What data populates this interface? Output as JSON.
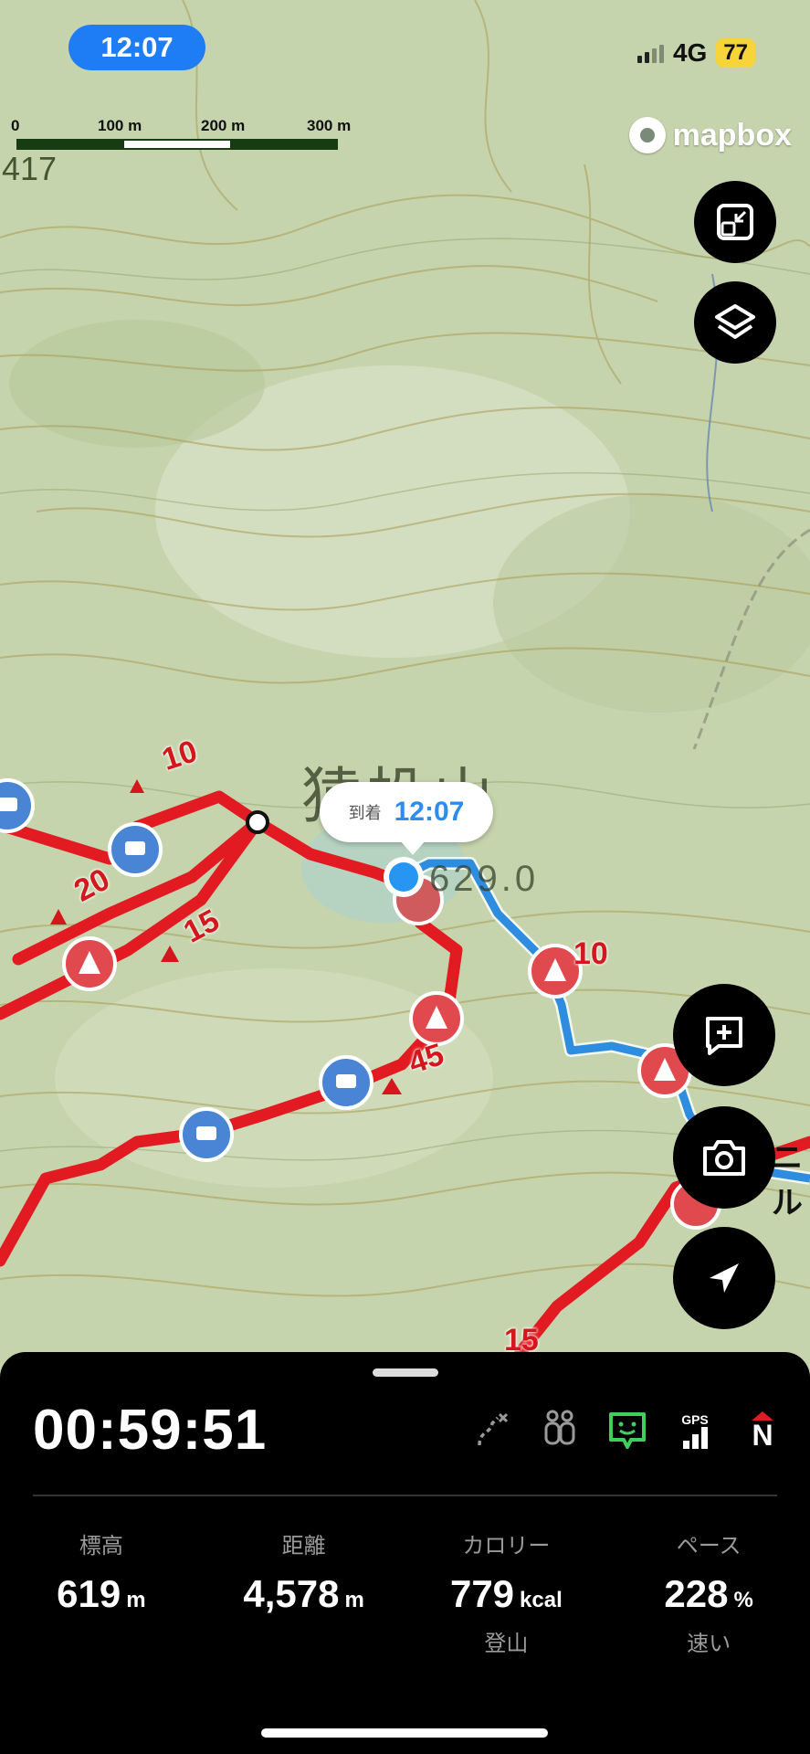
{
  "status_bar": {
    "time": "12:07",
    "network": "4G",
    "battery": "77"
  },
  "map": {
    "scale": {
      "labels": [
        "0",
        "100 m",
        "200 m",
        "300 m"
      ]
    },
    "attribution": "mapbox",
    "peak_name": "猿投山",
    "peak_elev": "629.0",
    "spot_height": "417",
    "arrival_label": {
      "prefix": "到着",
      "time": "12:07"
    },
    "slope_labels": [
      "10",
      "20",
      "15",
      "45",
      "10",
      "15"
    ],
    "side_label": "ニル"
  },
  "controls": {
    "expand": "expand-icon",
    "layers": "layers-icon",
    "add_note": "add-note-icon",
    "camera": "camera-icon",
    "locate": "location-arrow-icon"
  },
  "panel": {
    "elapsed": "00:59:51",
    "status_icons": [
      "route-off-icon",
      "hikers-icon",
      "chat-status-icon",
      "gps-icon",
      "compass-icon"
    ],
    "gps_text": "GPS",
    "compass_text": "N",
    "stats": [
      {
        "label": "標高",
        "value": "619",
        "unit": "m",
        "sub": ""
      },
      {
        "label": "距離",
        "value": "4,578",
        "unit": "m",
        "sub": ""
      },
      {
        "label": "カロリー",
        "value": "779",
        "unit": "kcal",
        "sub": "登山"
      },
      {
        "label": "ペース",
        "value": "228",
        "unit": "%",
        "sub": "速い"
      }
    ]
  },
  "colors": {
    "route_red": "#e21b23",
    "track_blue": "#2f8de0",
    "accent": "#1e7cf5"
  }
}
